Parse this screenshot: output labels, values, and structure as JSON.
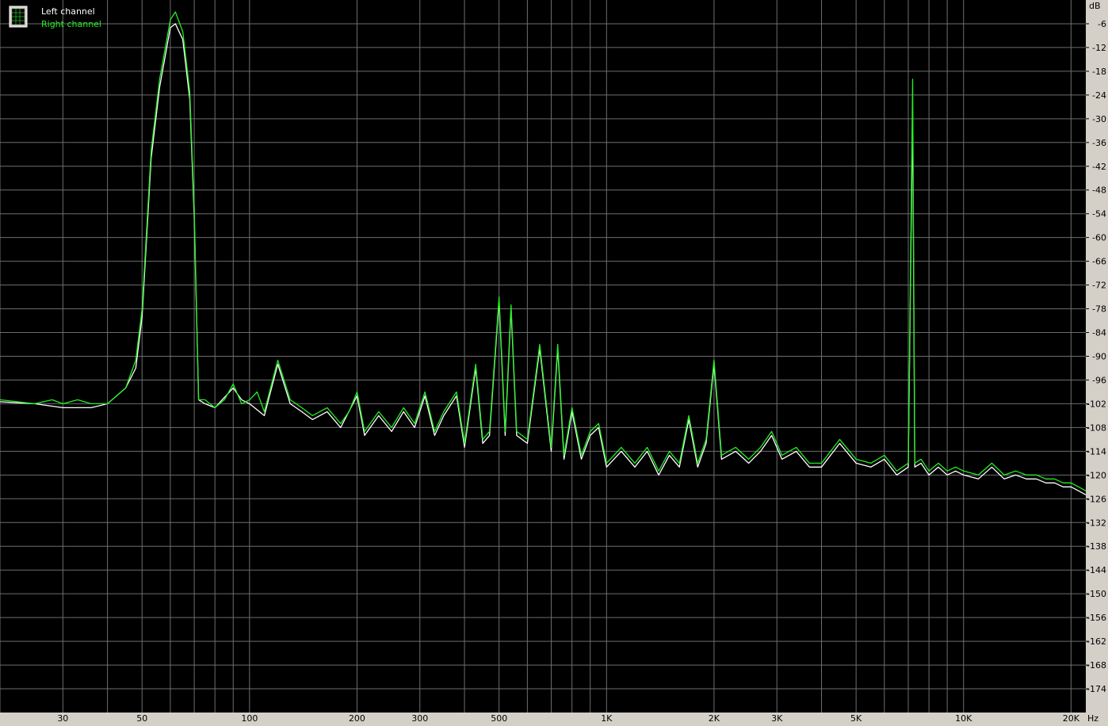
{
  "chart_data": {
    "type": "line",
    "title": "",
    "xlabel": "",
    "ylabel": "",
    "x_unit": "Hz",
    "y_unit": "dB",
    "x_scale": "log",
    "xlim": [
      20,
      22000
    ],
    "ylim": [
      -180,
      0
    ],
    "grid": true,
    "legend_placement": "top-left",
    "background_color": "#000000",
    "grid_color": "#6e6e6e",
    "axis_panel_color": "#d4d0c8",
    "x_ticks": [
      {
        "value": 30,
        "label": "30"
      },
      {
        "value": 50,
        "label": "50"
      },
      {
        "value": 100,
        "label": "100"
      },
      {
        "value": 200,
        "label": "200"
      },
      {
        "value": 300,
        "label": "300"
      },
      {
        "value": 500,
        "label": "500"
      },
      {
        "value": 1000,
        "label": "1K"
      },
      {
        "value": 2000,
        "label": "2K"
      },
      {
        "value": 3000,
        "label": "3K"
      },
      {
        "value": 5000,
        "label": "5K"
      },
      {
        "value": 10000,
        "label": "10K"
      },
      {
        "value": 20000,
        "label": "20K"
      }
    ],
    "y_ticks": [
      -6,
      -12,
      -18,
      -24,
      -30,
      -36,
      -42,
      -48,
      -54,
      -60,
      -66,
      -72,
      -78,
      -84,
      -90,
      -96,
      -102,
      -108,
      -114,
      -120,
      -126,
      -132,
      -138,
      -144,
      -150,
      -156,
      -162,
      -168,
      -174
    ],
    "series": [
      {
        "name": "Left channel",
        "color": "#ffffff",
        "points": [
          [
            20,
            -101.5
          ],
          [
            25,
            -102
          ],
          [
            30,
            -103
          ],
          [
            36,
            -103
          ],
          [
            40,
            -102
          ],
          [
            45,
            -98
          ],
          [
            48,
            -93
          ],
          [
            50,
            -80
          ],
          [
            53,
            -40
          ],
          [
            56,
            -22
          ],
          [
            60,
            -7
          ],
          [
            62,
            -6
          ],
          [
            65,
            -10
          ],
          [
            68,
            -25
          ],
          [
            70,
            -55
          ],
          [
            72,
            -101
          ],
          [
            75,
            -102
          ],
          [
            80,
            -103
          ],
          [
            90,
            -98
          ],
          [
            95,
            -101
          ],
          [
            100,
            -102
          ],
          [
            110,
            -105
          ],
          [
            120,
            -92
          ],
          [
            130,
            -102
          ],
          [
            140,
            -104
          ],
          [
            150,
            -106
          ],
          [
            165,
            -104
          ],
          [
            180,
            -108
          ],
          [
            200,
            -100
          ],
          [
            210,
            -110
          ],
          [
            230,
            -105
          ],
          [
            250,
            -109
          ],
          [
            270,
            -104
          ],
          [
            290,
            -108
          ],
          [
            310,
            -100
          ],
          [
            330,
            -110
          ],
          [
            350,
            -105
          ],
          [
            380,
            -100
          ],
          [
            400,
            -113
          ],
          [
            430,
            -93
          ],
          [
            450,
            -112
          ],
          [
            470,
            -110
          ],
          [
            500,
            -76
          ],
          [
            520,
            -110
          ],
          [
            540,
            -78
          ],
          [
            560,
            -110
          ],
          [
            600,
            -112
          ],
          [
            650,
            -88
          ],
          [
            700,
            -114
          ],
          [
            730,
            -88
          ],
          [
            760,
            -116
          ],
          [
            800,
            -104
          ],
          [
            850,
            -116
          ],
          [
            900,
            -110
          ],
          [
            950,
            -108
          ],
          [
            1000,
            -118
          ],
          [
            1100,
            -114
          ],
          [
            1200,
            -118
          ],
          [
            1300,
            -114
          ],
          [
            1400,
            -120
          ],
          [
            1500,
            -115
          ],
          [
            1600,
            -118
          ],
          [
            1700,
            -106
          ],
          [
            1800,
            -118
          ],
          [
            1900,
            -112
          ],
          [
            2000,
            -92
          ],
          [
            2100,
            -116
          ],
          [
            2300,
            -114
          ],
          [
            2500,
            -117
          ],
          [
            2700,
            -114
          ],
          [
            2900,
            -110
          ],
          [
            3100,
            -116
          ],
          [
            3400,
            -114
          ],
          [
            3700,
            -118
          ],
          [
            4000,
            -118
          ],
          [
            4500,
            -112
          ],
          [
            5000,
            -117
          ],
          [
            5500,
            -118
          ],
          [
            6000,
            -116
          ],
          [
            6500,
            -120
          ],
          [
            7000,
            -118
          ],
          [
            7200,
            -28
          ],
          [
            7300,
            -118
          ],
          [
            7600,
            -117
          ],
          [
            8000,
            -120
          ],
          [
            8500,
            -118
          ],
          [
            9000,
            -120
          ],
          [
            9500,
            -119
          ],
          [
            10000,
            -120
          ],
          [
            11000,
            -121
          ],
          [
            12000,
            -118
          ],
          [
            13000,
            -121
          ],
          [
            14000,
            -120
          ],
          [
            15000,
            -121
          ],
          [
            16000,
            -121
          ],
          [
            17000,
            -122
          ],
          [
            18000,
            -122
          ],
          [
            19000,
            -123
          ],
          [
            20000,
            -123
          ],
          [
            21000,
            -124
          ],
          [
            22000,
            -125
          ]
        ]
      },
      {
        "name": "Right channel",
        "color": "#22ee22",
        "points": [
          [
            20,
            -101
          ],
          [
            25,
            -102
          ],
          [
            28,
            -101
          ],
          [
            30,
            -102
          ],
          [
            33,
            -101
          ],
          [
            36,
            -102
          ],
          [
            40,
            -102
          ],
          [
            45,
            -98
          ],
          [
            48,
            -91
          ],
          [
            50,
            -78
          ],
          [
            53,
            -38
          ],
          [
            56,
            -20
          ],
          [
            60,
            -5
          ],
          [
            62,
            -3
          ],
          [
            65,
            -8
          ],
          [
            68,
            -23
          ],
          [
            70,
            -53
          ],
          [
            72,
            -101
          ],
          [
            75,
            -101
          ],
          [
            80,
            -103
          ],
          [
            85,
            -101
          ],
          [
            90,
            -97
          ],
          [
            95,
            -102
          ],
          [
            100,
            -101
          ],
          [
            105,
            -99
          ],
          [
            110,
            -104
          ],
          [
            120,
            -91
          ],
          [
            130,
            -101
          ],
          [
            140,
            -103
          ],
          [
            150,
            -105
          ],
          [
            165,
            -103
          ],
          [
            180,
            -107
          ],
          [
            190,
            -104
          ],
          [
            200,
            -99
          ],
          [
            210,
            -109
          ],
          [
            230,
            -104
          ],
          [
            250,
            -108
          ],
          [
            270,
            -103
          ],
          [
            290,
            -107
          ],
          [
            310,
            -99
          ],
          [
            330,
            -109
          ],
          [
            350,
            -104
          ],
          [
            380,
            -99
          ],
          [
            400,
            -112
          ],
          [
            430,
            -92
          ],
          [
            450,
            -111
          ],
          [
            470,
            -109
          ],
          [
            500,
            -75
          ],
          [
            520,
            -109
          ],
          [
            540,
            -77
          ],
          [
            560,
            -109
          ],
          [
            600,
            -111
          ],
          [
            650,
            -87
          ],
          [
            700,
            -113
          ],
          [
            730,
            -87
          ],
          [
            760,
            -115
          ],
          [
            800,
            -103
          ],
          [
            850,
            -115
          ],
          [
            900,
            -109
          ],
          [
            950,
            -107
          ],
          [
            1000,
            -117
          ],
          [
            1100,
            -113
          ],
          [
            1200,
            -117
          ],
          [
            1300,
            -113
          ],
          [
            1400,
            -119
          ],
          [
            1500,
            -114
          ],
          [
            1600,
            -117
          ],
          [
            1700,
            -105
          ],
          [
            1800,
            -117
          ],
          [
            1900,
            -111
          ],
          [
            2000,
            -91
          ],
          [
            2100,
            -115
          ],
          [
            2300,
            -113
          ],
          [
            2500,
            -116
          ],
          [
            2700,
            -113
          ],
          [
            2900,
            -109
          ],
          [
            3100,
            -115
          ],
          [
            3400,
            -113
          ],
          [
            3700,
            -117
          ],
          [
            4000,
            -117
          ],
          [
            4500,
            -111
          ],
          [
            5000,
            -116
          ],
          [
            5500,
            -117
          ],
          [
            6000,
            -115
          ],
          [
            6500,
            -119
          ],
          [
            7000,
            -117
          ],
          [
            7200,
            -20
          ],
          [
            7300,
            -117
          ],
          [
            7600,
            -116
          ],
          [
            8000,
            -119
          ],
          [
            8500,
            -117
          ],
          [
            9000,
            -119
          ],
          [
            9500,
            -118
          ],
          [
            10000,
            -119
          ],
          [
            11000,
            -120
          ],
          [
            12000,
            -117
          ],
          [
            13000,
            -120
          ],
          [
            14000,
            -119
          ],
          [
            15000,
            -120
          ],
          [
            16000,
            -120
          ],
          [
            17000,
            -121
          ],
          [
            18000,
            -121
          ],
          [
            19000,
            -122
          ],
          [
            20000,
            -122
          ],
          [
            21000,
            -123
          ],
          [
            22000,
            -124
          ]
        ]
      }
    ]
  }
}
